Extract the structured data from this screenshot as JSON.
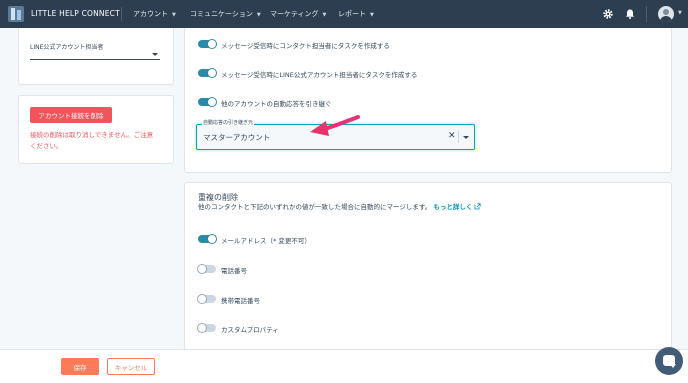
{
  "nav": {
    "brand": "LITTLE HELP CONNECT",
    "items": [
      {
        "label": "アカウント"
      },
      {
        "label": "コミュニケーション"
      },
      {
        "label": "マーケティング"
      },
      {
        "label": "レポート"
      }
    ]
  },
  "left": {
    "line_owner_label": "LINE公式アカウント担当者",
    "line_owner_value": "",
    "delete_button": "アカウント接続を削除",
    "delete_warning_line1": "接続の削除は取り消しできません。ご注意",
    "delete_warning_line2": "ください。"
  },
  "settings": {
    "toggle1_label": "メッセージ受信時にコンタクト担当者にタスクを作成する",
    "toggle2_label": "メッセージ受信時にLINE公式アカウント担当者にタスクを作成する",
    "toggle3_label": "他のアカウントの自動応答を引き継ぐ",
    "auto_reply_legend": "自動応答の引き継ぎ元",
    "auto_reply_value": "マスターアカウント"
  },
  "dedupe": {
    "title": "重複の削除",
    "desc": "他のコンタクトと下記のいずれかの値が一致した場合に自動的にマージします。",
    "learn_more": "もっと詳しく",
    "options": [
      {
        "label": "メールアドレス（* 変更不可）",
        "on": true
      },
      {
        "label": "電話番号",
        "on": false
      },
      {
        "label": "携帯電話番号",
        "on": false
      },
      {
        "label": "カスタムプロパティ",
        "on": false
      }
    ]
  },
  "footer": {
    "save": "保存",
    "cancel": "キャンセル"
  },
  "colors": {
    "nav_bg": "#2d3e50",
    "toggle_on": "#2a8ba8",
    "danger": "#f2545b",
    "save": "#ff7a59",
    "annotation_arrow": "#e8336d"
  },
  "icons": [
    "gear-icon",
    "bell-icon",
    "avatar",
    "close-icon",
    "caret-down-icon",
    "external-link-icon",
    "chat-icon"
  ]
}
